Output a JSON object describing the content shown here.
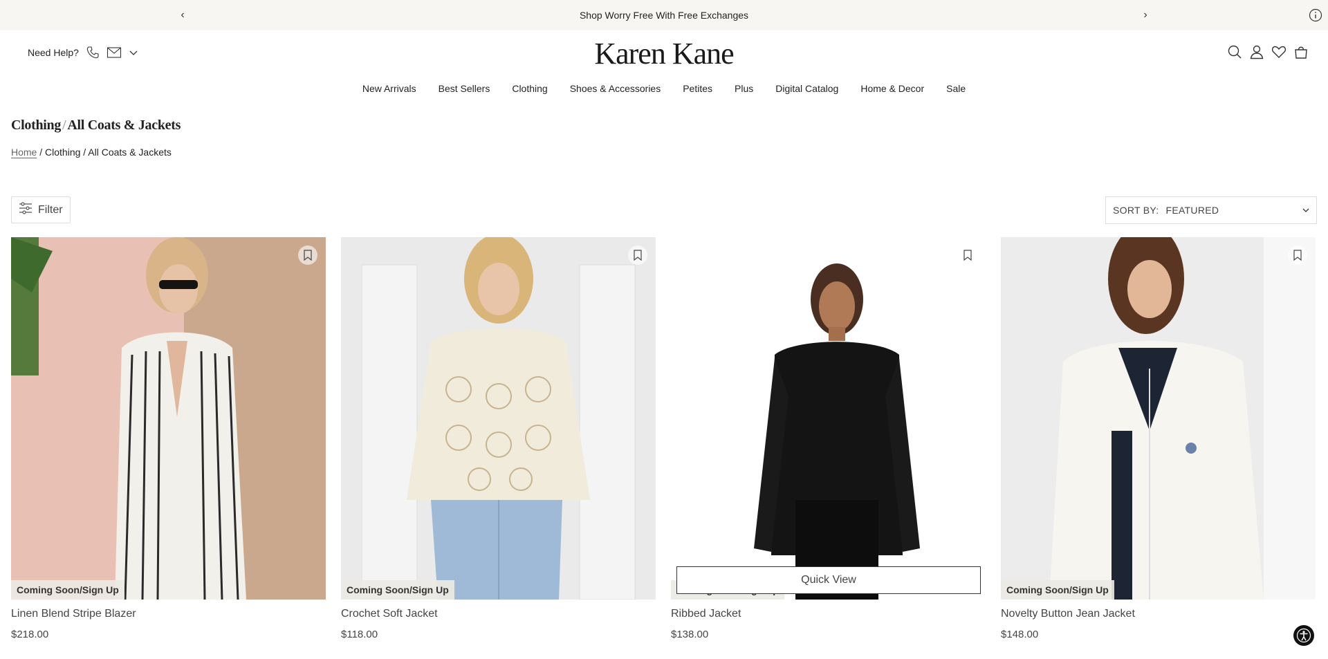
{
  "announcement": {
    "text": "Shop Worry Free With Free Exchanges"
  },
  "help": {
    "label": "Need Help?"
  },
  "brand": {
    "logo": "Karen Kane"
  },
  "nav": [
    {
      "label": "New Arrivals"
    },
    {
      "label": "Best Sellers"
    },
    {
      "label": "Clothing"
    },
    {
      "label": "Shoes & Accessories"
    },
    {
      "label": "Petites"
    },
    {
      "label": "Plus"
    },
    {
      "label": "Digital Catalog"
    },
    {
      "label": "Home & Decor"
    },
    {
      "label": "Sale"
    }
  ],
  "page": {
    "title_parent": "Clothing",
    "title_sep": "/",
    "title_current": "All Coats & Jackets"
  },
  "breadcrumb": {
    "home": "Home",
    "rest": " / Clothing / All Coats & Jackets"
  },
  "filter": {
    "label": "Filter"
  },
  "sort": {
    "label": "SORT BY:",
    "value": "FEATURED"
  },
  "products": [
    {
      "name": "Linen Blend Stripe Blazer",
      "price": "$218.00",
      "badge": "Coming Soon/Sign Up"
    },
    {
      "name": "Crochet Soft Jacket",
      "price": "$118.00",
      "badge": "Coming Soon/Sign Up"
    },
    {
      "name": "Ribbed Jacket",
      "price": "$138.00",
      "badge": "Coming Soon/Sign Up",
      "quick_view": "Quick View"
    },
    {
      "name": "Novelty Button Jean Jacket",
      "price": "$148.00",
      "badge": "Coming Soon/Sign Up"
    }
  ],
  "icons": {
    "prev": "chevron-left-icon",
    "next": "chevron-right-icon",
    "info": "info-icon",
    "phone": "phone-icon",
    "mail": "mail-icon",
    "search": "search-icon",
    "account": "user-icon",
    "wishlist": "heart-icon",
    "bag": "bag-icon",
    "filter": "sliders-icon",
    "bookmark": "bookmark-icon",
    "accessibility": "accessibility-icon"
  }
}
